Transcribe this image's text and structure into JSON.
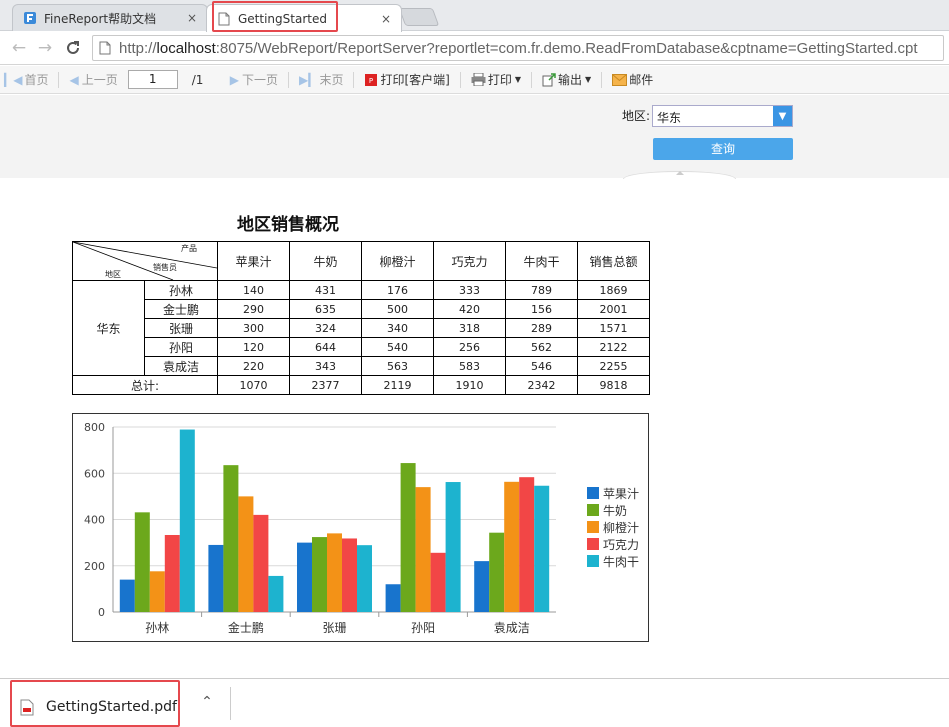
{
  "browser": {
    "tabs": [
      {
        "title": "FineReport帮助文档",
        "close": "×"
      },
      {
        "title": "GettingStarted",
        "close": "×"
      }
    ],
    "url_prefix": "http://",
    "url_host": "localhost",
    "url_rest": ":8075/WebReport/ReportServer?reportlet=com.fr.demo.ReadFromDatabase&cptname=GettingStarted.cpt"
  },
  "toolbar": {
    "first": "首页",
    "prev": "上一页",
    "page_value": "1",
    "page_total": "/1",
    "next": "下一页",
    "last": "末页",
    "print_client": "打印[客户端]",
    "print": "打印",
    "export": "输出",
    "mail": "邮件"
  },
  "params": {
    "region_label": "地区:",
    "region_value": "华东",
    "query_label": "查询"
  },
  "report": {
    "title": "地区销售概况",
    "header_corner": {
      "product": "产品",
      "seller": "销售员",
      "region": "地区"
    },
    "columns": [
      "苹果汁",
      "牛奶",
      "柳橙汁",
      "巧克力",
      "牛肉干",
      "销售总额"
    ],
    "region": "华东",
    "rows": [
      {
        "name": "孙林",
        "values": [
          "140",
          "431",
          "176",
          "333",
          "789",
          "1869"
        ]
      },
      {
        "name": "金士鹏",
        "values": [
          "290",
          "635",
          "500",
          "420",
          "156",
          "2001"
        ]
      },
      {
        "name": "张珊",
        "values": [
          "300",
          "324",
          "340",
          "318",
          "289",
          "1571"
        ]
      },
      {
        "name": "孙阳",
        "values": [
          "120",
          "644",
          "540",
          "256",
          "562",
          "2122"
        ]
      },
      {
        "name": "袁成洁",
        "values": [
          "220",
          "343",
          "563",
          "583",
          "546",
          "2255"
        ]
      }
    ],
    "total_label": "总计:",
    "totals": [
      "1070",
      "2377",
      "2119",
      "1910",
      "2342",
      "9818"
    ]
  },
  "chart_data": {
    "type": "bar",
    "categories": [
      "孙林",
      "金士鹏",
      "张珊",
      "孙阳",
      "袁成洁"
    ],
    "series": [
      {
        "name": "苹果汁",
        "color": "#1874cd",
        "values": [
          140,
          290,
          300,
          120,
          220
        ]
      },
      {
        "name": "牛奶",
        "color": "#6ca81c",
        "values": [
          431,
          635,
          324,
          644,
          343
        ]
      },
      {
        "name": "柳橙汁",
        "color": "#f39217",
        "values": [
          176,
          500,
          340,
          540,
          563
        ]
      },
      {
        "name": "巧克力",
        "color": "#f24646",
        "values": [
          333,
          420,
          318,
          256,
          583
        ]
      },
      {
        "name": "牛肉干",
        "color": "#1db3cf",
        "values": [
          789,
          156,
          289,
          562,
          546
        ]
      }
    ],
    "yticks": [
      "0",
      "200",
      "400",
      "600",
      "800"
    ],
    "ylim": [
      0,
      800
    ],
    "grid": true,
    "legend": "right"
  },
  "downloads": {
    "file": "GettingStarted.pdf"
  }
}
